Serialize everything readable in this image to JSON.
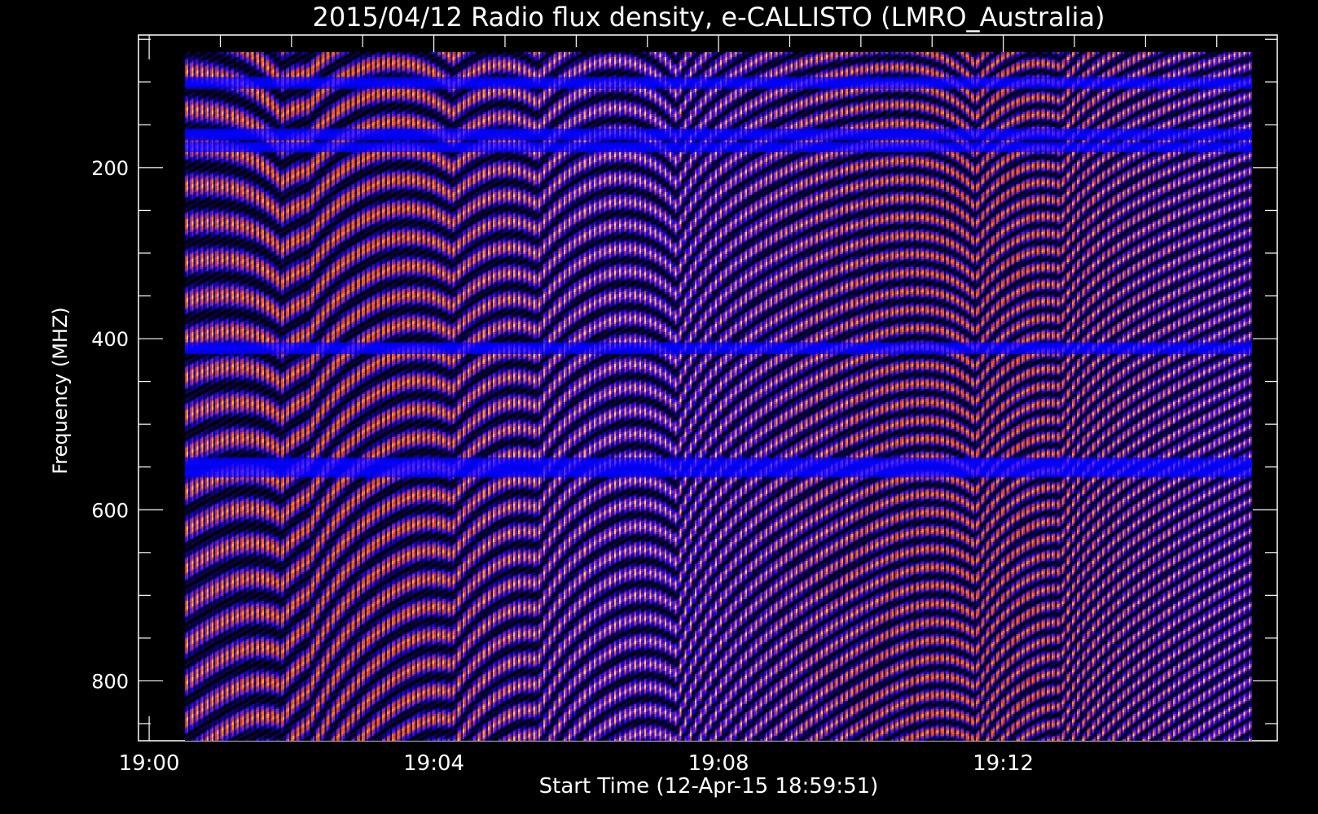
{
  "chart_data": {
    "type": "heatmap",
    "title": "2015/04/12  Radio flux density, e-CALLISTO (LMRO_Australia)",
    "xlabel": "Start Time (12-Apr-15 18:59:51)",
    "ylabel": "Frequency (MHZ)",
    "x_axis": {
      "unit": "minutes",
      "range": [
        "18:59:51",
        "19:15:51"
      ],
      "data_range": [
        "19:00:30",
        "19:15:30"
      ],
      "major_ticks": [
        "19:00",
        "19:04",
        "19:08",
        "19:12"
      ],
      "minor_tick_interval_minutes": 1
    },
    "y_axis": {
      "unit": "MHz",
      "inverted": true,
      "range": [
        45,
        870
      ],
      "data_range": [
        65,
        870
      ],
      "major_ticks": [
        200,
        400,
        600,
        800
      ],
      "minor_tick_interval": 50
    },
    "colormap": [
      "#000000",
      "#1a00ff",
      "#7a2bcc",
      "#d8303a",
      "#ff7a00",
      "#ffd84a"
    ],
    "features": {
      "interference_bands_mhz": [
        100,
        160,
        175,
        410,
        545,
        555
      ],
      "pattern": "wavy striated interference fringes across full band"
    }
  }
}
